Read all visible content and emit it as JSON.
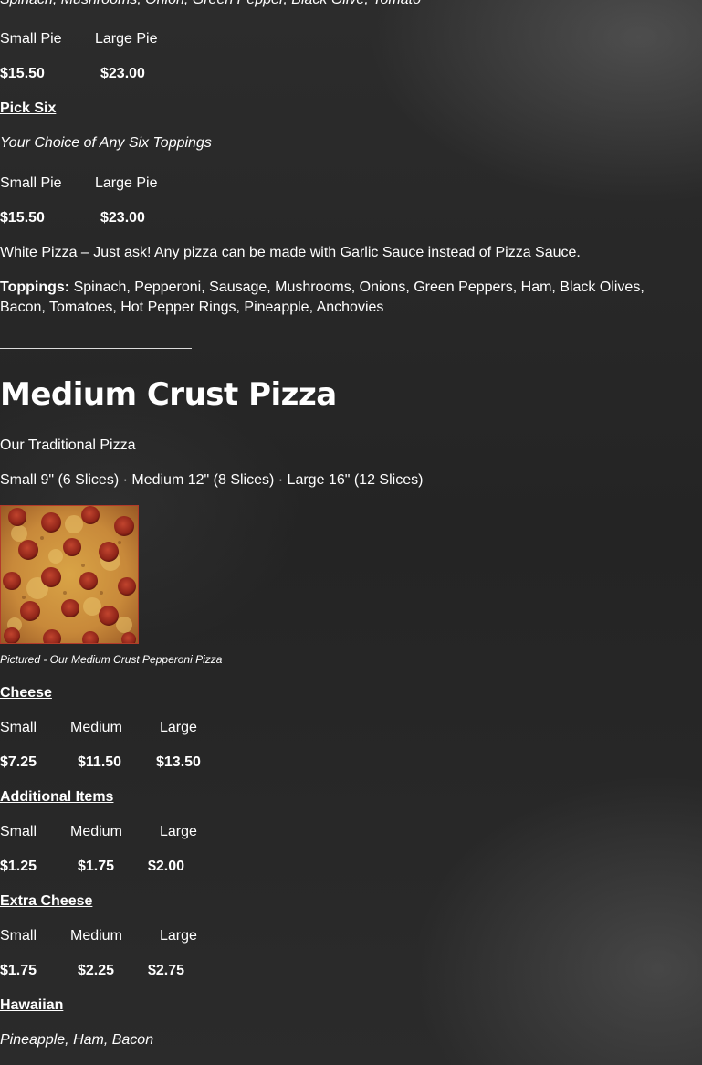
{
  "top_items": {
    "veggie_toppings": "Spinach, Mushrooms, Onion, Green Pepper, Black Olive, Tomato",
    "sizes": [
      "Small Pie",
      "Large Pie"
    ],
    "prices": [
      "$15.50",
      "$23.00"
    ]
  },
  "pick_six": {
    "name": "Pick Six",
    "description": "Your Choice of Any Six Toppings",
    "sizes": [
      "Small Pie",
      "Large Pie"
    ],
    "prices": [
      "$15.50",
      "$23.00"
    ]
  },
  "white_pizza_note": "White Pizza – Just ask! Any pizza can be made with Garlic Sauce instead of Pizza Sauce.",
  "toppings": {
    "label": "Toppings:",
    "list": "Spinach, Pepperoni, Sausage, Mushrooms, Onions, Green Peppers, Ham, Black Olives, Bacon, Tomatoes, Hot Pepper Rings, Pineapple, Anchovies"
  },
  "medium_crust": {
    "heading": "Medium Crust Pizza",
    "subtitle": "Our Traditional Pizza",
    "size_info": "Small 9\" (6 Slices) · Medium 12\" (8 Slices) · Large 16\" (12 Slices)",
    "photo_caption": "Pictured - Our Medium Crust Pepperoni Pizza",
    "sections": [
      {
        "name": "Cheese",
        "sizes": [
          "Small",
          "Medium",
          "Large"
        ],
        "prices": [
          "$7.25",
          "$11.50",
          "$13.50"
        ]
      },
      {
        "name": "Additional Items",
        "sizes": [
          "Small",
          "Medium",
          "Large"
        ],
        "prices": [
          "$1.25",
          "$1.75",
          "$2.00"
        ]
      },
      {
        "name": "Extra Cheese",
        "sizes": [
          "Small",
          "Medium",
          "Large"
        ],
        "prices": [
          "$1.75",
          "$2.25",
          "$2.75"
        ]
      }
    ],
    "hawaiian": {
      "name": "Hawaiian",
      "description": "Pineapple, Ham, Bacon"
    }
  },
  "colors": {
    "background": "#2a2a2a",
    "text": "#ffffff",
    "photo_border": "#b23a2a"
  }
}
